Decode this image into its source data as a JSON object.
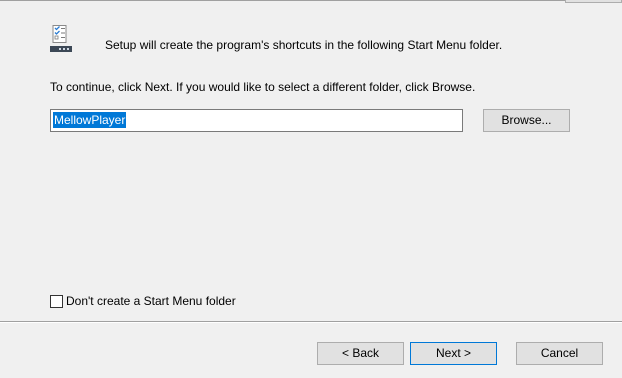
{
  "header": {
    "icon": "start-menu-shortcuts-icon",
    "text": "Setup will create the program's shortcuts in the following Start Menu folder."
  },
  "instruction": "To continue, click Next. If you would like to select a different folder, click Browse.",
  "folder": {
    "value": "MellowPlayer",
    "selected": true
  },
  "buttons": {
    "browse": "Browse...",
    "back": "< Back",
    "next": "Next >",
    "cancel": "Cancel"
  },
  "checkbox": {
    "label": "Don't create a Start Menu folder",
    "checked": false
  },
  "colors": {
    "window_bg": "#f0f0f0",
    "selection": "#0078d7",
    "button_bg": "#e1e1e1",
    "default_button_border": "#0078d7"
  }
}
